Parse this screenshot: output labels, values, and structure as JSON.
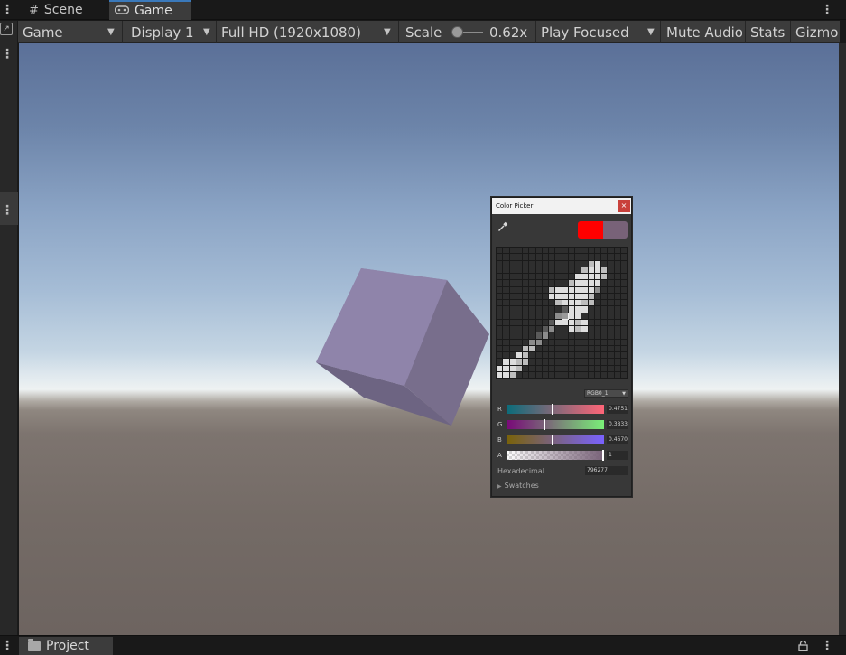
{
  "tabs": [
    {
      "label": "Scene",
      "icon": "grid-icon"
    },
    {
      "label": "Game",
      "icon": "gamepad-icon"
    }
  ],
  "toolbar": {
    "render_mode": "Game",
    "display": "Display 1",
    "resolution": "Full HD (1920x1080)",
    "scale_label": "Scale",
    "scale_value": "0.62x",
    "play_mode": "Play Focused",
    "mute_audio": "Mute Audio",
    "stats": "Stats",
    "gizmos": "Gizmo"
  },
  "scene": {
    "sky_top": "#5b7098",
    "horizon": "#eef2f2",
    "ground": "#746b66",
    "cube_color": "#8e82a6"
  },
  "color_picker": {
    "title": "Color Picker",
    "close": "×",
    "new_color": "#ff0000",
    "old_color": "#786278",
    "mode": "RGB0_1",
    "channels": [
      {
        "label": "R",
        "value": "0.4751",
        "fraction": 0.4751
      },
      {
        "label": "G",
        "value": "0.3833",
        "fraction": 0.3833
      },
      {
        "label": "B",
        "value": "0.4670",
        "fraction": 0.467
      },
      {
        "label": "A",
        "value": "1",
        "fraction": 1.0
      }
    ],
    "hex_label": "Hexadecimal",
    "hex_value": "796277",
    "swatches_label": "Swatches"
  },
  "bottom": {
    "project_tab": "Project"
  }
}
